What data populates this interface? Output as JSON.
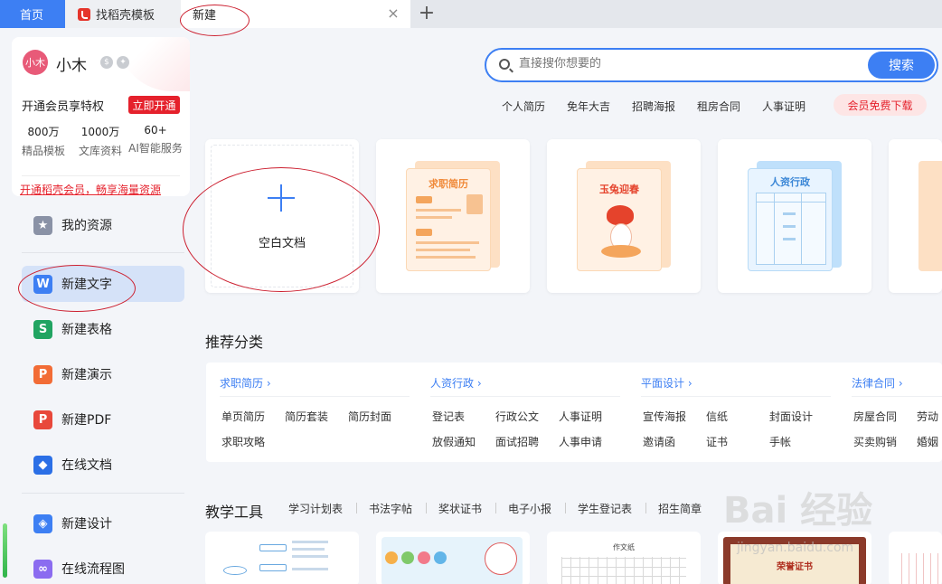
{
  "tabs": {
    "home": "首页",
    "templates": "找稻壳模板",
    "new": "新建",
    "close": "×",
    "add": "+"
  },
  "user": {
    "avatar_text": "小木",
    "name": "小木",
    "vip_title": "开通会员享特权",
    "vip_button": "立即开通",
    "stats": [
      {
        "num": "800万",
        "label": "精品模板"
      },
      {
        "num": "1000万",
        "label": "文库资料"
      },
      {
        "num": "60+",
        "label": "AI智能服务"
      }
    ],
    "promo": "开通稻壳会员，畅享海量资源"
  },
  "sidebar": {
    "resources": "我的资源",
    "items": [
      {
        "label": "新建文字",
        "icon": "word-icon",
        "color": "#3d7ff3",
        "glyph": "W"
      },
      {
        "label": "新建表格",
        "icon": "sheet-icon",
        "color": "#21a462",
        "glyph": "S"
      },
      {
        "label": "新建演示",
        "icon": "slides-icon",
        "color": "#f26c36",
        "glyph": "P"
      },
      {
        "label": "新建PDF",
        "icon": "pdf-icon",
        "color": "#e8483b",
        "glyph": "P"
      },
      {
        "label": "在线文档",
        "icon": "online-doc-icon",
        "color": "#2b6fe6",
        "glyph": "◆"
      },
      {
        "label": "新建设计",
        "icon": "design-icon",
        "color": "#3d7ff3",
        "glyph": "◈"
      },
      {
        "label": "在线流程图",
        "icon": "flowchart-icon",
        "color": "#8b6cf0",
        "glyph": "∞"
      }
    ]
  },
  "search": {
    "placeholder": "直接搜你想要的",
    "button": "搜索",
    "hot_links": [
      "个人简历",
      "免年大吉",
      "招聘海报",
      "租房合同",
      "人事证明"
    ],
    "vip_download": "会员免费下载"
  },
  "templates": {
    "blank": "空白文档",
    "cards": [
      "求职简历",
      "玉兔迎春",
      "人资行政"
    ]
  },
  "recommend": {
    "title": "推荐分类",
    "groups": [
      {
        "title": "求职简历",
        "items": [
          "单页简历",
          "简历套装",
          "简历封面",
          "求职攻略"
        ]
      },
      {
        "title": "人资行政",
        "items": [
          "登记表",
          "行政公文",
          "人事证明",
          "放假通知",
          "面试招聘",
          "人事申请"
        ]
      },
      {
        "title": "平面设计",
        "items": [
          "宣传海报",
          "信纸",
          "封面设计",
          "邀请函",
          "证书",
          "手帐"
        ]
      },
      {
        "title": "法律合同",
        "items": [
          "房屋合同",
          "劳动",
          "买卖购销",
          "婚姻"
        ]
      }
    ]
  },
  "tools": {
    "title": "教学工具",
    "tabs": [
      "学习计划表",
      "书法字帖",
      "奖状证书",
      "电子小报",
      "学生登记表",
      "招生简章"
    ],
    "card_labels": [
      "作文纸",
      "荣誉证书"
    ]
  },
  "watermark": {
    "main": "Bai 经验",
    "sub": "jingyan.baidu.com"
  }
}
